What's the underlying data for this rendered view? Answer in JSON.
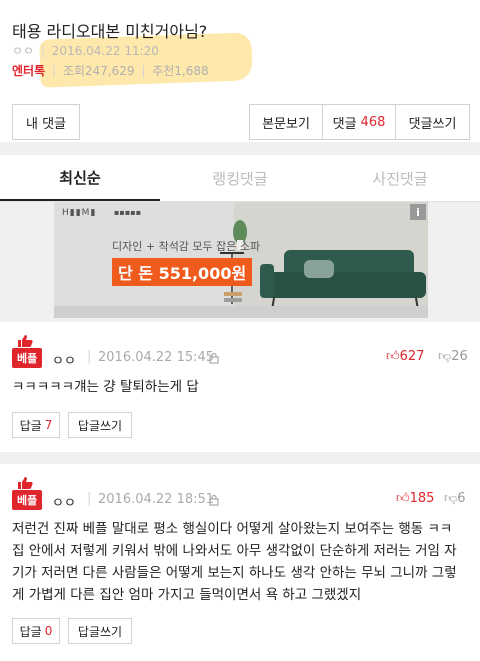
{
  "post": {
    "title": "태용 라디오대본 미친거아님?",
    "author_mask": "ㅇㅇ",
    "date": "2016.04.22 11:20",
    "category": "엔터톡",
    "views": "조회247,629",
    "recommend": "추천1,688"
  },
  "actions": {
    "my_comments": "내 댓글",
    "view_post": "본문보기",
    "comments_label": "댓글",
    "comments_count": "468",
    "write_comment": "댓글쓰기"
  },
  "tabs": [
    "최신순",
    "랭킹댓글",
    "사진댓글"
  ],
  "ad": {
    "tagline": "디자인 + 착석감 모두 잡은 소파",
    "price": "단 돈 551,000원",
    "info": "i"
  },
  "comments": [
    {
      "badge": "베플",
      "user": "ㅇㅇ",
      "date": "2016.04.22 15:45",
      "up": "627",
      "down": "26",
      "text": "ㅋㅋㅋㅋㅋ걔는 걍 탈퇴하는게 답",
      "reply_label": "답글",
      "reply_count": "7",
      "write_reply": "답글쓰기"
    },
    {
      "badge": "베플",
      "user": "ㅇㅇ",
      "date": "2016.04.22 18:51",
      "up": "185",
      "down": "6",
      "text": "저런건 진짜 베플 말대로 평소 행실이다 어떻게 살아왔는지 보여주는 행동 ㅋㅋ 집 안에서 저렇게 키워서 밖에 나와서도 아무 생각없이 단순하게 저러는 거임 자기가 저러면 다른 사람들은 어떻게 보는지 하나도 생각 안하는 무뇌 그니까 그렇게 가볍게 다른 집안 엄마 가지고 들먹이면서 욕 하고 그랬겠지",
      "reply_label": "답글",
      "reply_count": "0",
      "write_reply": "답글쓰기"
    }
  ]
}
